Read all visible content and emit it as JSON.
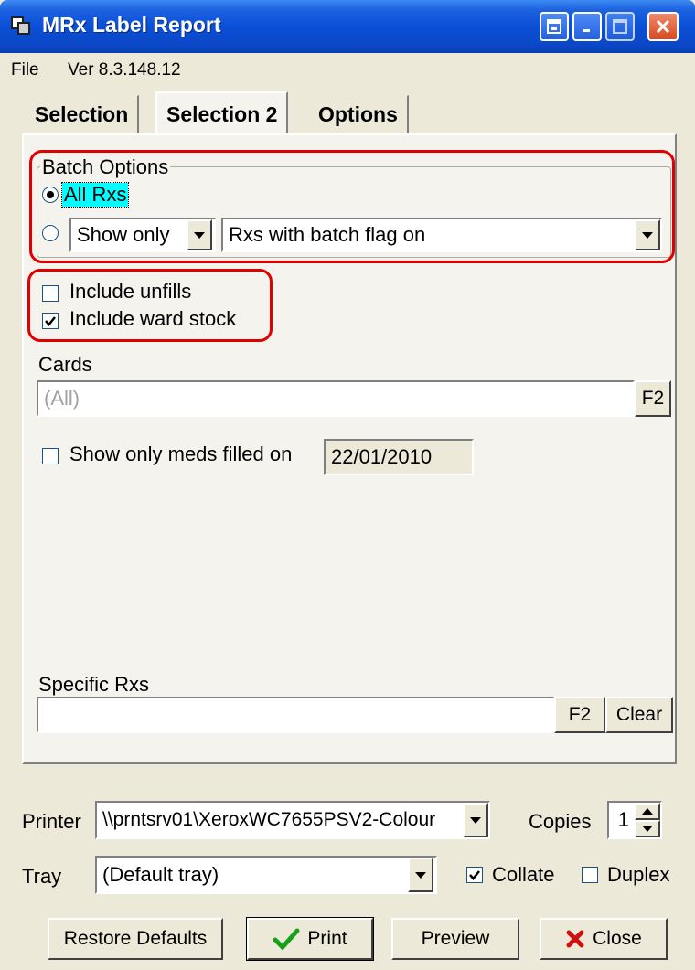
{
  "window": {
    "title": "MRx Label Report",
    "icon": "app-window-icon",
    "controls": [
      "restore-icon",
      "minimize-icon",
      "maximize-icon",
      "close-icon"
    ]
  },
  "menu": {
    "file": "File",
    "version": "Ver 8.3.148.12"
  },
  "tabs": [
    {
      "label": "Selection",
      "selected": false
    },
    {
      "label": "Selection 2",
      "selected": true
    },
    {
      "label": "Options",
      "selected": false
    }
  ],
  "batch": {
    "group_title": "Batch Options",
    "all_rxs": "All Rxs",
    "show_mode": "Show only",
    "flag_option": "Rxs with batch flag on"
  },
  "include": {
    "unfills": "Include unfills",
    "ward_stock": "Include ward stock"
  },
  "cards": {
    "label": "Cards",
    "value": "(All)",
    "button": "F2"
  },
  "filled_on": {
    "label": "Show only meds filled on",
    "date": "22/01/2010"
  },
  "specific_rxs": {
    "label": "Specific Rxs",
    "value": "",
    "f2": "F2",
    "clear": "Clear"
  },
  "printer": {
    "label": "Printer",
    "value": "\\\\prntsrv01\\XeroxWC7655PSV2-Colour",
    "copies_label": "Copies",
    "copies": "1"
  },
  "tray": {
    "label": "Tray",
    "value": "(Default tray)",
    "collate": "Collate",
    "duplex": "Duplex"
  },
  "buttons": {
    "restore": "Restore Defaults",
    "print": "Print",
    "preview": "Preview",
    "close": "Close"
  },
  "colors": {
    "title_bar": "#0a4fd6",
    "highlight": "#00ffff",
    "annotation": "#e00000"
  }
}
